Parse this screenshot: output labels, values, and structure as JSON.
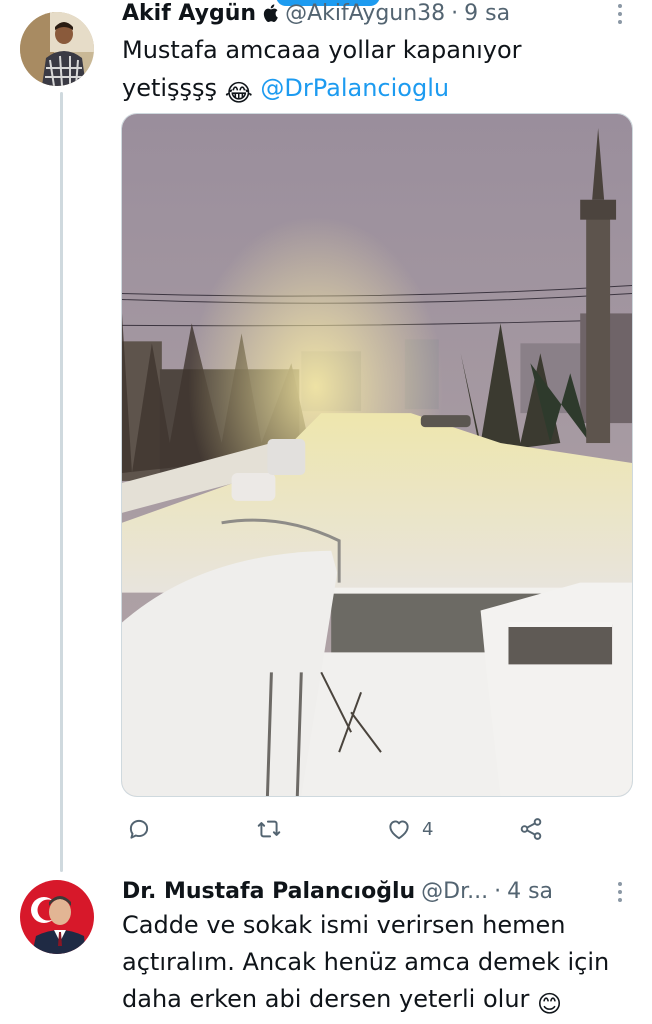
{
  "tweet1": {
    "author_name": "Akif Aygün",
    "author_handle": "@AkifAygun38",
    "separator": "·",
    "time": "9 sa",
    "text_line1": "Mustafa amcaaa yollar kapanıyor",
    "text_line2_prefix": "yetişşşş",
    "emoji": "😂",
    "mention": "@DrPalancioglu",
    "actions": {
      "reply_count": "",
      "retweet_count": "",
      "like_count": "4"
    }
  },
  "tweet2": {
    "author_name": "Dr. Mustafa Palancıoğlu",
    "author_handle": "@Dr...",
    "separator": "·",
    "time": "4 sa",
    "text_line1": "Cadde ve sokak ismi verirsen hemen",
    "text_line2": "açtıralım. Ancak henüz amca demek için",
    "text_line3": "daha erken abi dersen yeterli olur",
    "emoji": "😊"
  },
  "icons": {
    "reply": "reply-icon",
    "retweet": "retweet-icon",
    "like": "heart-icon",
    "share": "share-icon",
    "more": "more-options-icon",
    "apple": "apple-icon"
  },
  "colors": {
    "link": "#1d9bf0",
    "secondary_text": "#536471",
    "thread_line": "#cfd9de"
  }
}
